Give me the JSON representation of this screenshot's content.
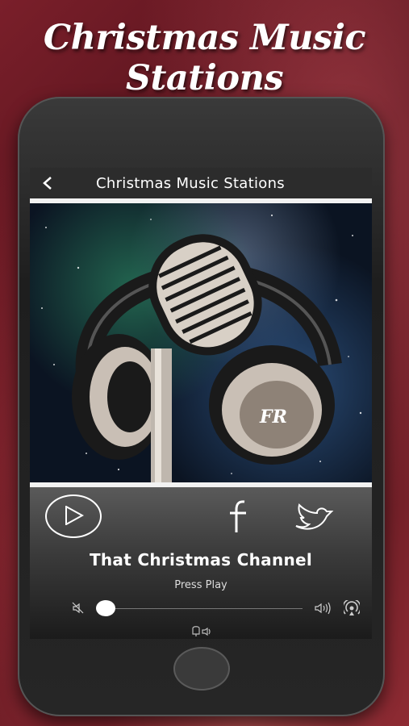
{
  "promo": {
    "title": "Christmas Music Stations"
  },
  "app_bar": {
    "back_icon": "back-arrow",
    "title": "Christmas Music Stations"
  },
  "artwork": {
    "badge_text": "FR"
  },
  "player": {
    "station_name": "That Christmas Channel",
    "status": "Press Play",
    "volume_fraction": 0.0,
    "icons": [
      "play-icon",
      "facebook-icon",
      "twitter-icon",
      "mute-icon",
      "volume-icon",
      "cast-icon",
      "alarm-icon"
    ]
  },
  "colors": {
    "app_bar": "#2c2c2c",
    "divider": "#f2f2f2",
    "text": "#ffffff"
  }
}
